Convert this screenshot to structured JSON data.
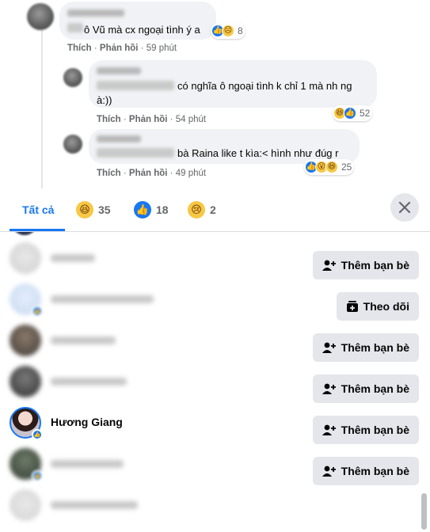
{
  "comments": [
    {
      "text": "ô Vũ mà cx ngoại tình ý a",
      "actions": {
        "like": "Thích",
        "reply": "Phản hồi",
        "time": "59 phút"
      },
      "reaction_count": "8",
      "reactions": [
        "like-icon",
        "sad-icon"
      ]
    },
    {
      "text_line1": "có nghĩa ô ngoại tình k chỉ 1 mà nh ng",
      "text_line2": "à:))",
      "actions": {
        "like": "Thích",
        "reply": "Phản hồi",
        "time": "54 phút"
      },
      "reaction_count": "52",
      "reactions": [
        "haha-icon",
        "like-icon"
      ]
    },
    {
      "text": "bà Raina like t kìa:< hình như đúg r",
      "actions": {
        "like": "Thích",
        "reply": "Phản hồi",
        "time": "49 phút"
      },
      "reaction_count": "25",
      "reactions": [
        "like-icon",
        "wow-icon",
        "haha-icon"
      ]
    }
  ],
  "tabs": [
    {
      "label": "Tất cả",
      "active": true
    },
    {
      "icon": "haha-icon",
      "count": "35"
    },
    {
      "icon": "like-icon",
      "count": "18"
    },
    {
      "icon": "sad-icon",
      "count": "2"
    }
  ],
  "close_icon": "close-icon",
  "people": [
    {
      "name": "",
      "button": "Thêm bạn bè",
      "button_icon": "add-friend-icon"
    },
    {
      "name": "",
      "button": "Theo dõi",
      "button_icon": "follow-icon"
    },
    {
      "name": "",
      "button": "Thêm bạn bè",
      "button_icon": "add-friend-icon"
    },
    {
      "name": "",
      "button": "Thêm bạn bè",
      "button_icon": "add-friend-icon"
    },
    {
      "name": "Hương Giang",
      "button": "Thêm bạn bè",
      "button_icon": "add-friend-icon"
    },
    {
      "name": "",
      "button": "Thêm bạn bè",
      "button_icon": "add-friend-icon"
    },
    {
      "name": "",
      "button": "",
      "button_icon": ""
    }
  ],
  "colors": {
    "accent": "#1877f2",
    "bubble": "#f0f2f5",
    "button": "#e4e6eb",
    "muted_text": "#65676b"
  }
}
